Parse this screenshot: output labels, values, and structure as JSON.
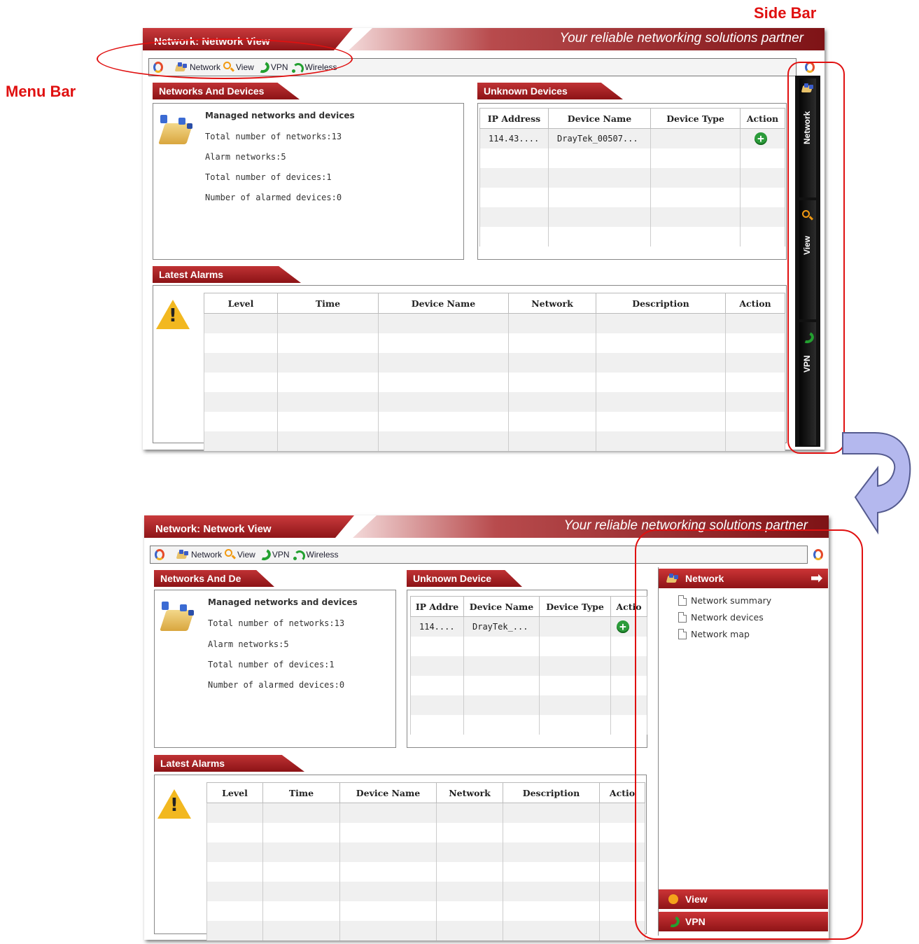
{
  "annotations": {
    "menu_bar": "Menu Bar",
    "side_bar": "Side Bar"
  },
  "app": {
    "title": "Network: Network View",
    "slogan": "Your reliable networking solutions partner",
    "menu": [
      {
        "label": "Network",
        "icon": "network-icon"
      },
      {
        "label": "View",
        "icon": "magnifier-icon"
      },
      {
        "label": "VPN",
        "icon": "vpn-icon"
      },
      {
        "label": "Wireless",
        "icon": "wireless-icon"
      }
    ],
    "networks": {
      "title": "Networks And Devices",
      "title_short": "Networks And De",
      "heading": "Managed networks and devices",
      "lines": [
        "Total number of networks:13",
        "Alarm networks:5",
        "Total number of devices:1",
        "Number of alarmed devices:0"
      ]
    },
    "unknown": {
      "title": "Unknown Devices",
      "title_short": "Unknown Device",
      "columns": [
        "IP Address",
        "Device Name",
        "Device Type",
        "Action"
      ],
      "columns_short": [
        "IP Addre",
        "Device Name",
        "Device Type",
        "Actio"
      ],
      "row": {
        "ip": "114.43....",
        "name": "DrayTek_00507...",
        "type": ""
      },
      "row_short": {
        "ip": "114....",
        "name": "DrayTek_..."
      }
    },
    "alarms": {
      "title": "Latest Alarms",
      "columns": [
        "Level",
        "Time",
        "Device Name",
        "Network",
        "Description",
        "Action"
      ],
      "columns_short": [
        "Level",
        "Time",
        "Device Name",
        "Network",
        "Description",
        "Actio"
      ]
    },
    "sidebar_tabs": [
      "Network",
      "View",
      "VPN"
    ],
    "expanded_sidebar": {
      "header": "Network",
      "items": [
        "Network summary",
        "Network devices",
        "Network map"
      ],
      "footer": [
        "View",
        "VPN"
      ]
    }
  },
  "colors": {
    "accent_red": "#b42a2d",
    "annotation_red": "#e01010",
    "arrow_blue": "#b4b8ee"
  }
}
